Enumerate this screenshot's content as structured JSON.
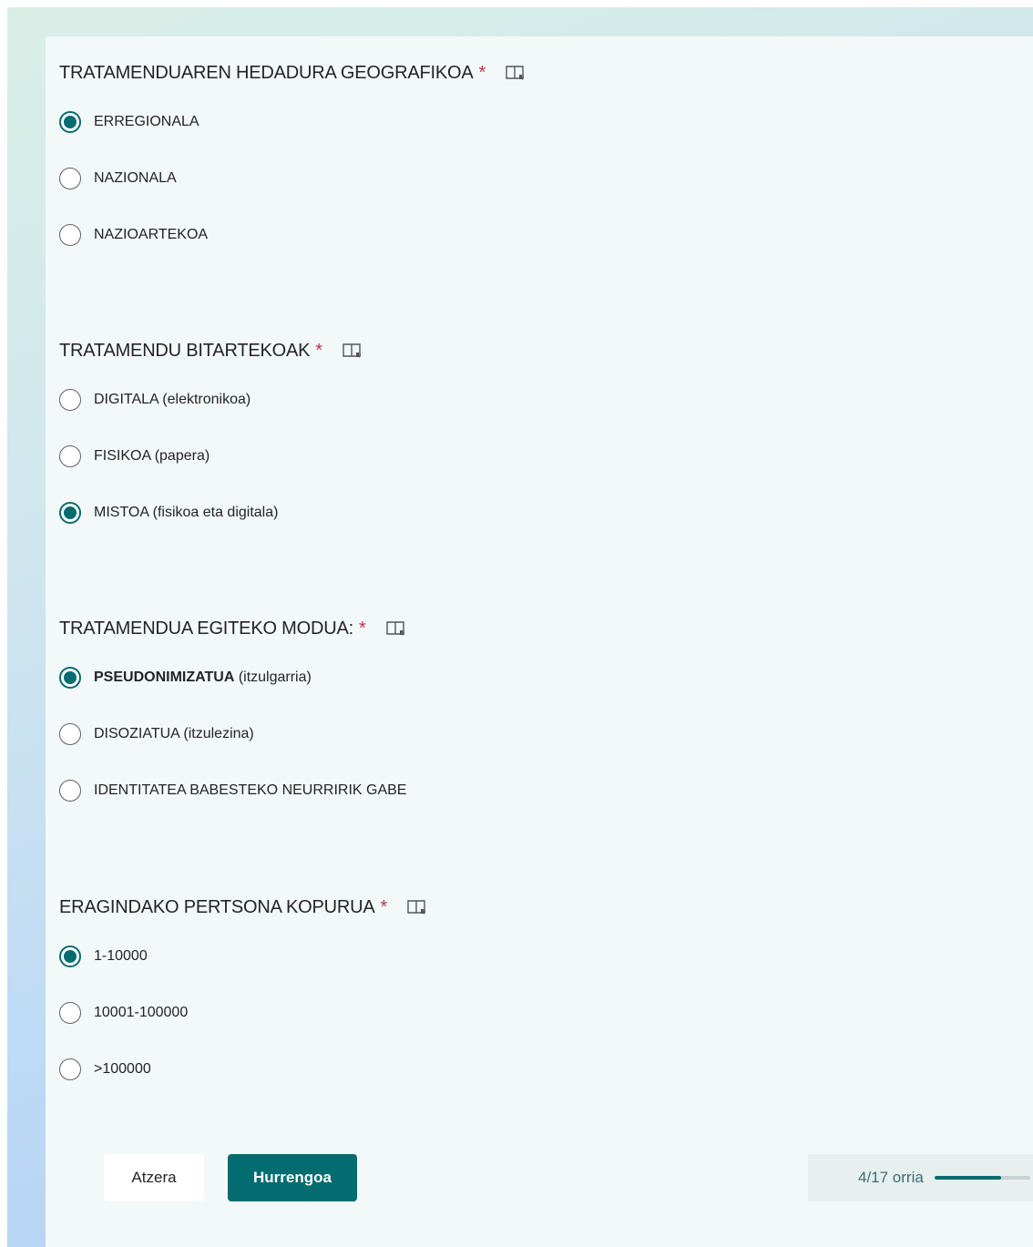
{
  "questions": [
    {
      "title": "TRATAMENDUAREN HEDADURA GEOGRAFIKOA",
      "required_mark": "*",
      "options": [
        {
          "label": "ERREGIONALA",
          "suffix": "",
          "checked": true
        },
        {
          "label": "NAZIONALA",
          "suffix": "",
          "checked": false
        },
        {
          "label": "NAZIOARTEKOA",
          "suffix": "",
          "checked": false
        }
      ]
    },
    {
      "title": "TRATAMENDU BITARTEKOAK",
      "required_mark": "*",
      "options": [
        {
          "label": "DIGITALA (elektronikoa)",
          "suffix": "",
          "checked": false
        },
        {
          "label": "FISIKOA (papera)",
          "suffix": "",
          "checked": false
        },
        {
          "label": "MISTOA (fisikoa eta digitala)",
          "suffix": "",
          "checked": true
        }
      ]
    },
    {
      "title": "TRATAMENDUA EGITEKO MODUA:",
      "required_mark": "*",
      "options": [
        {
          "label": "PSEUDONIMIZATUA",
          "suffix": " (itzulgarria)",
          "checked": true
        },
        {
          "label": "DISOZIATUA (itzulezina)",
          "suffix": "",
          "checked": false
        },
        {
          "label": "IDENTITATEA BABESTEKO NEURRIRIK GABE",
          "suffix": "",
          "checked": false
        }
      ]
    },
    {
      "title": "ERAGINDAKO PERTSONA KOPURUA",
      "required_mark": "*",
      "options": [
        {
          "label": "1-10000",
          "suffix": "",
          "checked": true
        },
        {
          "label": "10001-100000",
          "suffix": "",
          "checked": false
        },
        {
          "label": ">100000",
          "suffix": "",
          "checked": false
        }
      ]
    }
  ],
  "navigation": {
    "back_label": "Atzera",
    "next_label": "Hurrengoa",
    "page_indicator": "4/17 orria",
    "progress_fraction": 0.7
  },
  "colors": {
    "accent": "#036c70",
    "required": "#c4314b"
  }
}
